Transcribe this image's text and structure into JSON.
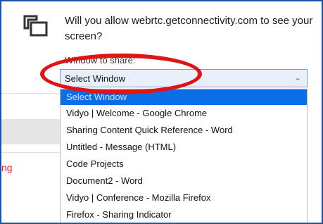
{
  "prompt": {
    "message": "Will you allow webrtc.getconnectivity.com to see your screen?",
    "window_label": "Window to share:"
  },
  "select": {
    "value": "Select Window",
    "chevron_icon": "chevron-down-icon"
  },
  "dropdown": {
    "options": [
      {
        "label": "Select Window",
        "selected": true
      },
      {
        "label": "Vidyo | Welcome - Google Chrome"
      },
      {
        "label": "Sharing Content Quick Reference - Word"
      },
      {
        "label": "Untitled - Message (HTML)"
      },
      {
        "label": "Code Projects"
      },
      {
        "label": "Document2 - Word"
      },
      {
        "label": "Vidyo | Conference - Mozilla Firefox"
      },
      {
        "label": "Firefox - Sharing Indicator"
      }
    ]
  },
  "background": {
    "partial_text": "ng"
  },
  "icons": {
    "share_screen": "screen-share-icon"
  },
  "colors": {
    "frame_border": "#1f4fa8",
    "highlight_ring": "#e11414",
    "selected_option": "#0a6ee6",
    "select_background": "#e8f1fb",
    "background_text": "#e0262e"
  }
}
